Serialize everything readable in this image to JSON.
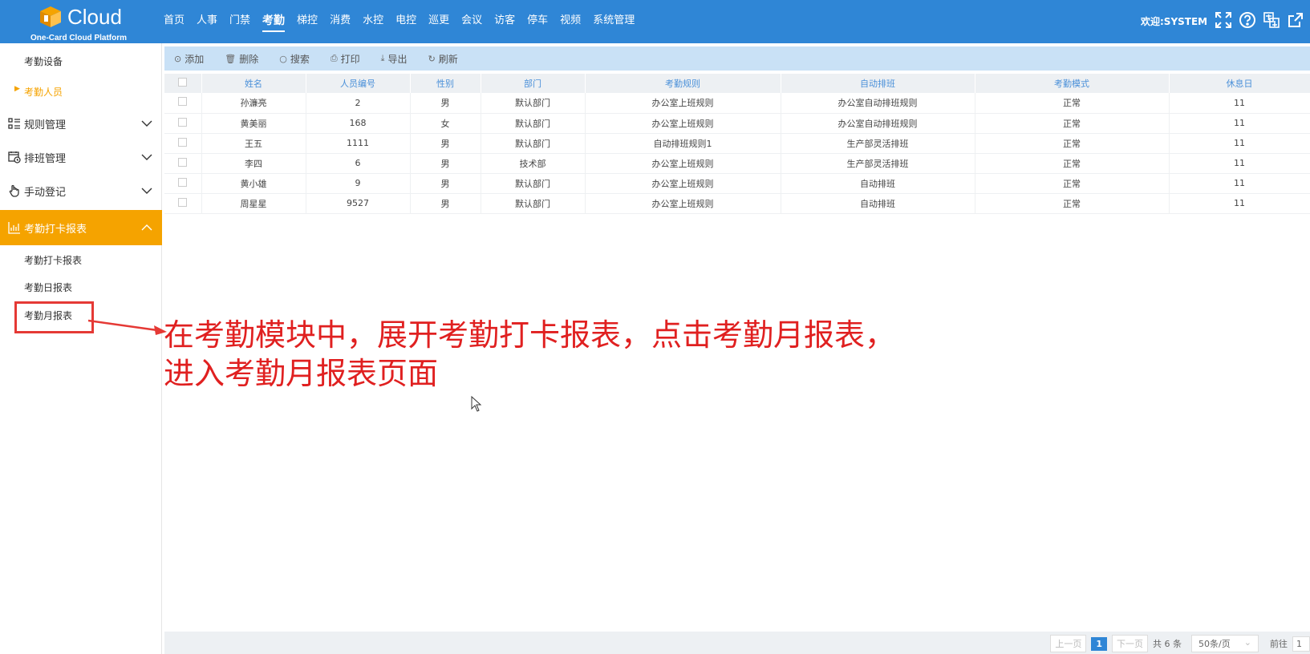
{
  "brand": {
    "name": "Cloud",
    "subtitle": "One-Card Cloud Platform"
  },
  "nav": [
    {
      "label": "首页",
      "active": false
    },
    {
      "label": "人事",
      "active": false
    },
    {
      "label": "门禁",
      "active": false
    },
    {
      "label": "考勤",
      "active": true
    },
    {
      "label": "梯控",
      "active": false
    },
    {
      "label": "消费",
      "active": false
    },
    {
      "label": "水控",
      "active": false
    },
    {
      "label": "电控",
      "active": false
    },
    {
      "label": "巡更",
      "active": false
    },
    {
      "label": "会议",
      "active": false
    },
    {
      "label": "访客",
      "active": false
    },
    {
      "label": "停车",
      "active": false
    },
    {
      "label": "视频",
      "active": false
    },
    {
      "label": "系统管理",
      "active": false
    }
  ],
  "header": {
    "welcome": "欢迎:SYSTEM",
    "icons": [
      "fullscreen-icon",
      "help-icon",
      "language-icon",
      "external-link-icon",
      "power-icon"
    ]
  },
  "sidebar": {
    "top_items": [
      "考勤设备",
      "考勤人员"
    ],
    "groups": [
      {
        "label": "规则管理",
        "icon": "list-icon",
        "open": false
      },
      {
        "label": "排班管理",
        "icon": "calendar-icon",
        "open": false
      },
      {
        "label": "手动登记",
        "icon": "hand-icon",
        "open": false
      },
      {
        "label": "考勤打卡报表",
        "icon": "chart-icon",
        "open": true
      }
    ],
    "report_items": [
      "考勤打卡报表",
      "考勤日报表",
      "考勤月报表"
    ]
  },
  "toolbar": {
    "add": "添加",
    "delete": "删除",
    "search": "搜索",
    "print": "打印",
    "export": "导出",
    "refresh": "刷新"
  },
  "table": {
    "headers": [
      "姓名",
      "人员编号",
      "性别",
      "部门",
      "考勤规则",
      "自动排班",
      "考勤模式",
      "休息日"
    ],
    "rows": [
      [
        "孙濂亮",
        "2",
        "男",
        "默认部门",
        "办公室上班规则",
        "办公室自动排班规则",
        "正常",
        "11"
      ],
      [
        "黄美丽",
        "168",
        "女",
        "默认部门",
        "办公室上班规则",
        "办公室自动排班规则",
        "正常",
        "11"
      ],
      [
        "王五",
        "1111",
        "男",
        "默认部门",
        "自动排班规则1",
        "生产部灵活排班",
        "正常",
        "11"
      ],
      [
        "李四",
        "6",
        "男",
        "技术部",
        "办公室上班规则",
        "生产部灵活排班",
        "正常",
        "11"
      ],
      [
        "黄小雄",
        "9",
        "男",
        "默认部门",
        "办公室上班规则",
        "自动排班",
        "正常",
        "11"
      ],
      [
        "周星星",
        "9527",
        "男",
        "默认部门",
        "办公室上班规则",
        "自动排班",
        "正常",
        "11"
      ]
    ]
  },
  "pager": {
    "prev": "上一页",
    "current": "1",
    "next": "下一页",
    "total": "共 6 条",
    "page_size": "50条/页",
    "goto": "前往",
    "goto_value": "1"
  },
  "annotation": {
    "line1": "在考勤模块中，展开考勤打卡报表，点击考勤月报表，",
    "line2": "进入考勤月报表页面"
  },
  "colors": {
    "topbar": "#2f86d6",
    "accent_orange": "#f5a300",
    "annotation_red": "#e02020",
    "toolbar_bg": "#c9e1f6"
  }
}
